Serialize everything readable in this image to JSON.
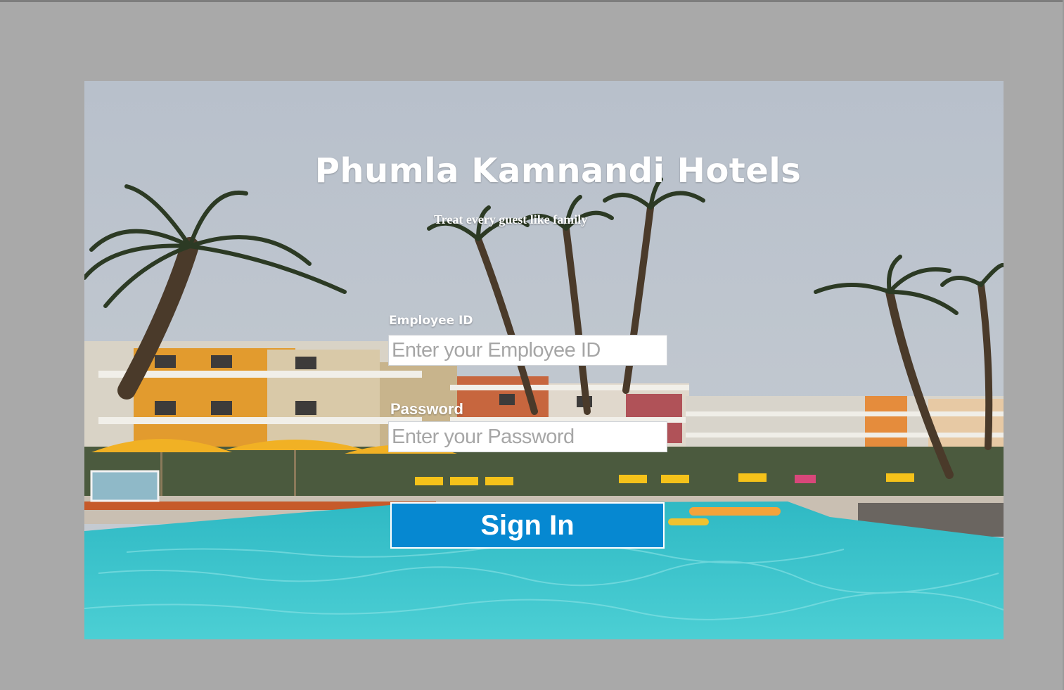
{
  "app": {
    "title": "Phumla Kamnandi Hotels",
    "tagline": "Treat every guest like family"
  },
  "login_form": {
    "employee_id": {
      "label": "Employee ID",
      "value": "",
      "placeholder": "Enter your Employee ID"
    },
    "password": {
      "label": "Password",
      "value": "",
      "placeholder": "Enter your Password"
    },
    "sign_in_label": "Sign In"
  },
  "background_image": "hotel-pool-with-palm-trees",
  "colors": {
    "window_background": "#a9a9a9",
    "sign_in_button": "#0688d1",
    "text": "#ffffff",
    "pool_water": "#3fc6cf"
  }
}
